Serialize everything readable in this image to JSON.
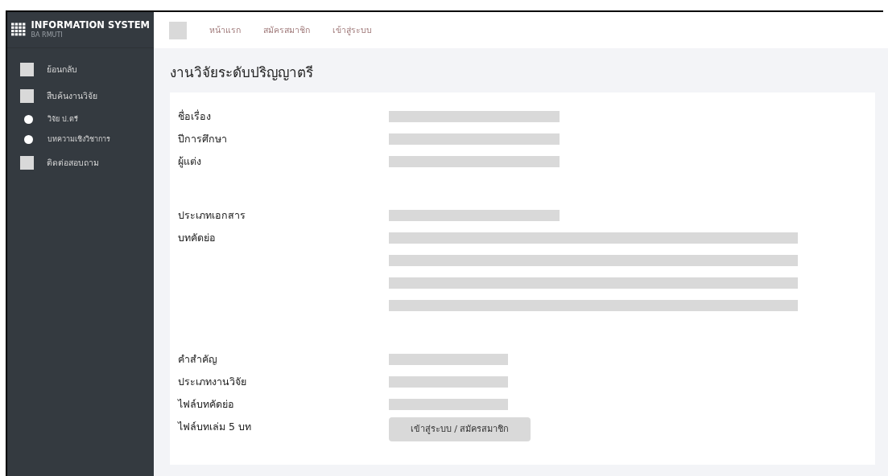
{
  "brand": {
    "title": "INFORMATION SYSTEM",
    "subtitle": "BA RMUTI"
  },
  "nav": [
    "หน้าแรก",
    "สมัครสมาชิก",
    "เข้าสู่ระบบ"
  ],
  "sidebar": {
    "items": [
      {
        "label": "ย้อนกลับ",
        "kind": "square"
      },
      {
        "label": "สืบค้นงานวิจัย",
        "kind": "square"
      },
      {
        "label": "วิจัย ป.ตรี",
        "kind": "dot"
      },
      {
        "label": "บทความเชิงวิชาการ",
        "kind": "dot"
      },
      {
        "label": "ติดต่อสอบถาม",
        "kind": "square"
      }
    ]
  },
  "page_title": "งานวิจัยระดับปริญญาตรี",
  "groups": [
    [
      {
        "label": "ชื่อเรื่อง",
        "kind": "bar"
      },
      {
        "label": "ปีการศึกษา",
        "kind": "bar"
      },
      {
        "label": "ผู้แต่ง",
        "kind": "bar"
      }
    ],
    [
      {
        "label": "ประเภทเอกสาร",
        "kind": "bar"
      },
      {
        "label": "บทคัดย่อ",
        "kind": "paragraph"
      }
    ],
    [
      {
        "label": "คำสำคัญ",
        "kind": "shortbar"
      },
      {
        "label": "ประเภทงานวิจัย",
        "kind": "shortbar"
      },
      {
        "label": "ไฟล์บทคัดย่อ",
        "kind": "shortbar"
      },
      {
        "label": "ไฟล์บทเล่ม 5 บท",
        "kind": "button",
        "text": "เข้าสู่ระบบ / สมัครสมาชิก"
      }
    ]
  ]
}
